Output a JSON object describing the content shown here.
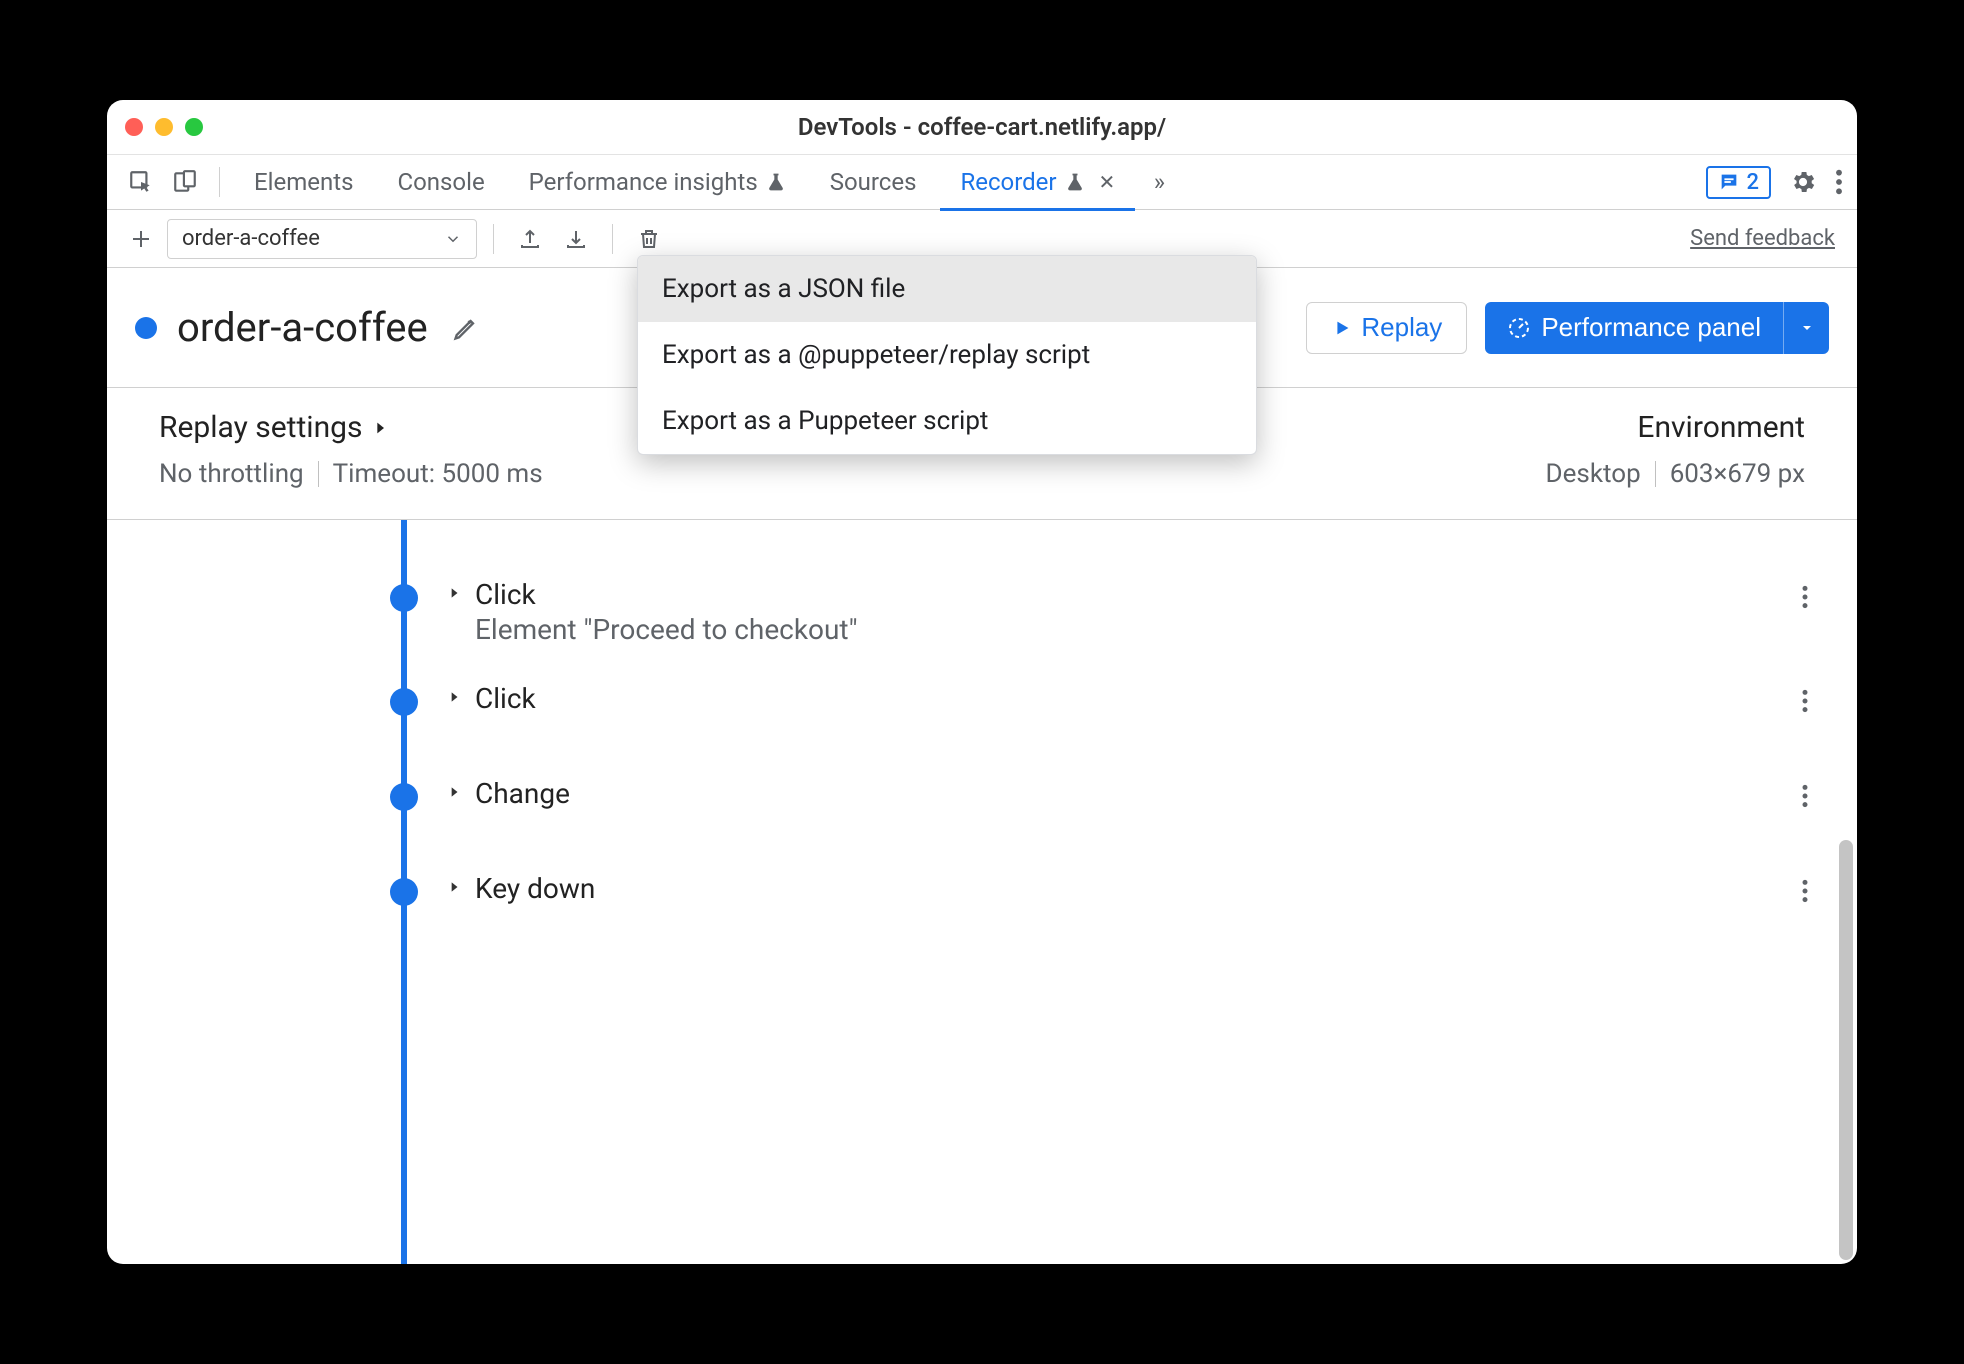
{
  "window": {
    "title": "DevTools - coffee-cart.netlify.app/"
  },
  "tabs": {
    "elements": "Elements",
    "console": "Console",
    "perf_insights": "Performance insights",
    "sources": "Sources",
    "recorder": "Recorder"
  },
  "messages_count": "2",
  "toolbar": {
    "recording_name": "order-a-coffee",
    "send_feedback": "Send feedback"
  },
  "header": {
    "recording_title": "order-a-coffee",
    "replay_label": "Replay",
    "perf_label": "Performance panel"
  },
  "export_menu": {
    "item1": "Export as a JSON file",
    "item2": "Export as a @puppeteer/replay script",
    "item3": "Export as a Puppeteer script"
  },
  "settings": {
    "replay_heading": "Replay settings",
    "throttle": "No throttling",
    "timeout": "Timeout: 5000 ms",
    "env_heading": "Environment",
    "device": "Desktop",
    "viewport": "603×679 px"
  },
  "steps": [
    {
      "label": "Click",
      "detail": "Element \"Proceed to checkout\""
    },
    {
      "label": "Click",
      "detail": ""
    },
    {
      "label": "Change",
      "detail": ""
    },
    {
      "label": "Key down",
      "detail": ""
    }
  ]
}
